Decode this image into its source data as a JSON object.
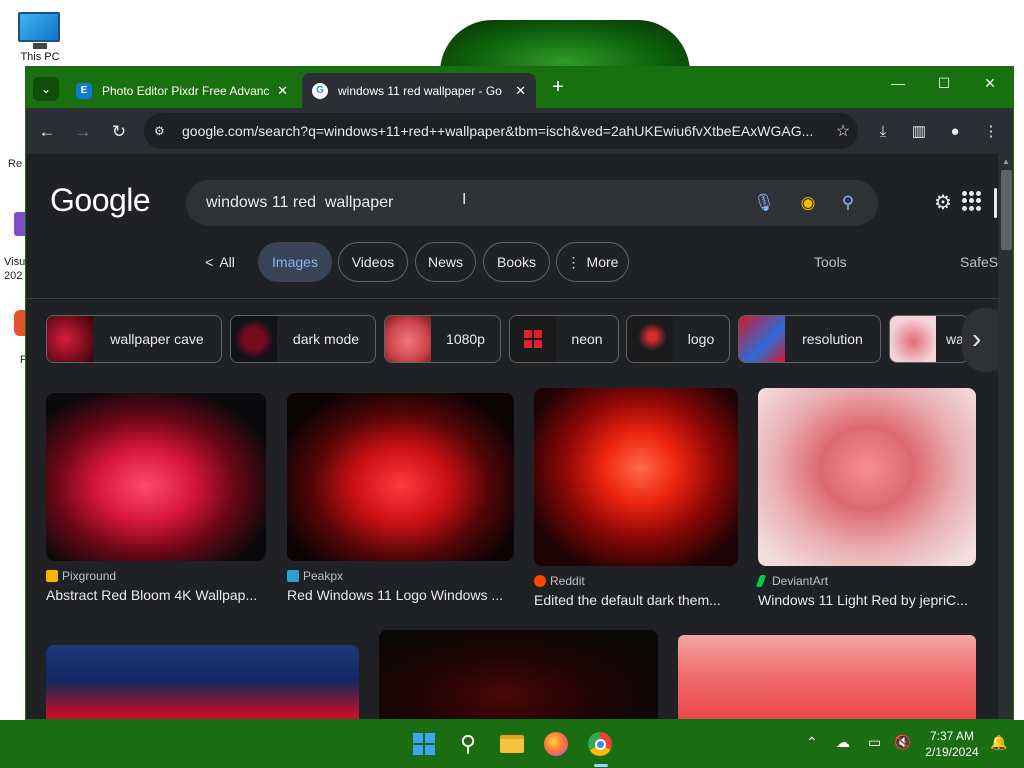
{
  "desktop": {
    "icons": [
      {
        "label": "This PC",
        "icon": "monitor-icon"
      }
    ],
    "peek_labels": [
      "Re",
      "Visu",
      "202",
      "F"
    ]
  },
  "browser": {
    "tab_search_icon": "chevron-down-icon",
    "tabs": [
      {
        "title": "Photo Editor Pixdr Free Advance",
        "favicon": "pixlr-icon",
        "active": false
      },
      {
        "title": "windows 11 red wallpaper - Go",
        "favicon": "google-icon",
        "active": true
      }
    ],
    "new_tab": "+",
    "window_controls": {
      "minimize": "—",
      "maximize": "☐",
      "close": "✕"
    },
    "toolbar": {
      "back": "←",
      "forward": "→",
      "reload": "↻",
      "url": "google.com/search?q=windows+11+red++wallpaper&tbm=isch&ved=2ahUKEwiu6fvXtbeEAxWGAG..."
    }
  },
  "search": {
    "logo": "Google",
    "query": "windows 11 red  wallpaper",
    "filters": [
      {
        "label": "All",
        "prefix": "<",
        "selected": false
      },
      {
        "label": "Images",
        "selected": true
      },
      {
        "label": "Videos",
        "selected": false
      },
      {
        "label": "News",
        "selected": false
      },
      {
        "label": "Books",
        "selected": false
      },
      {
        "label": "More",
        "prefix": "⋮",
        "selected": false
      }
    ],
    "tools": "Tools",
    "safesearch": "SafeS",
    "related": [
      "wallpaper cave",
      "dark mode",
      "1080p",
      "neon",
      "logo",
      "resolution",
      "wa"
    ]
  },
  "results": [
    {
      "source": "Pixground",
      "title": "Abstract Red Bloom 4K Wallpap...",
      "source_color": "#f4b400"
    },
    {
      "source": "Peakpx",
      "title": "Red Windows 11 Logo Windows ...",
      "source_color": "#2a9fd6"
    },
    {
      "source": "Reddit",
      "title": "Edited the default dark them...",
      "source_color": "#ff4500"
    },
    {
      "source": "DeviantArt",
      "title": "Windows 11 Light Red by jepriC...",
      "source_color": "#05cc47"
    }
  ],
  "taskbar": {
    "apps": [
      "windows-start-icon",
      "search-icon",
      "file-explorer-icon",
      "firefox-icon",
      "chrome-icon"
    ],
    "clock": {
      "time": "7:37 AM",
      "date": "2/19/2024"
    }
  },
  "colors": {
    "titlebar": "#18700f",
    "taskbar": "#1b6d12",
    "page_bg": "#202124",
    "accent": "#8ab4f8"
  }
}
